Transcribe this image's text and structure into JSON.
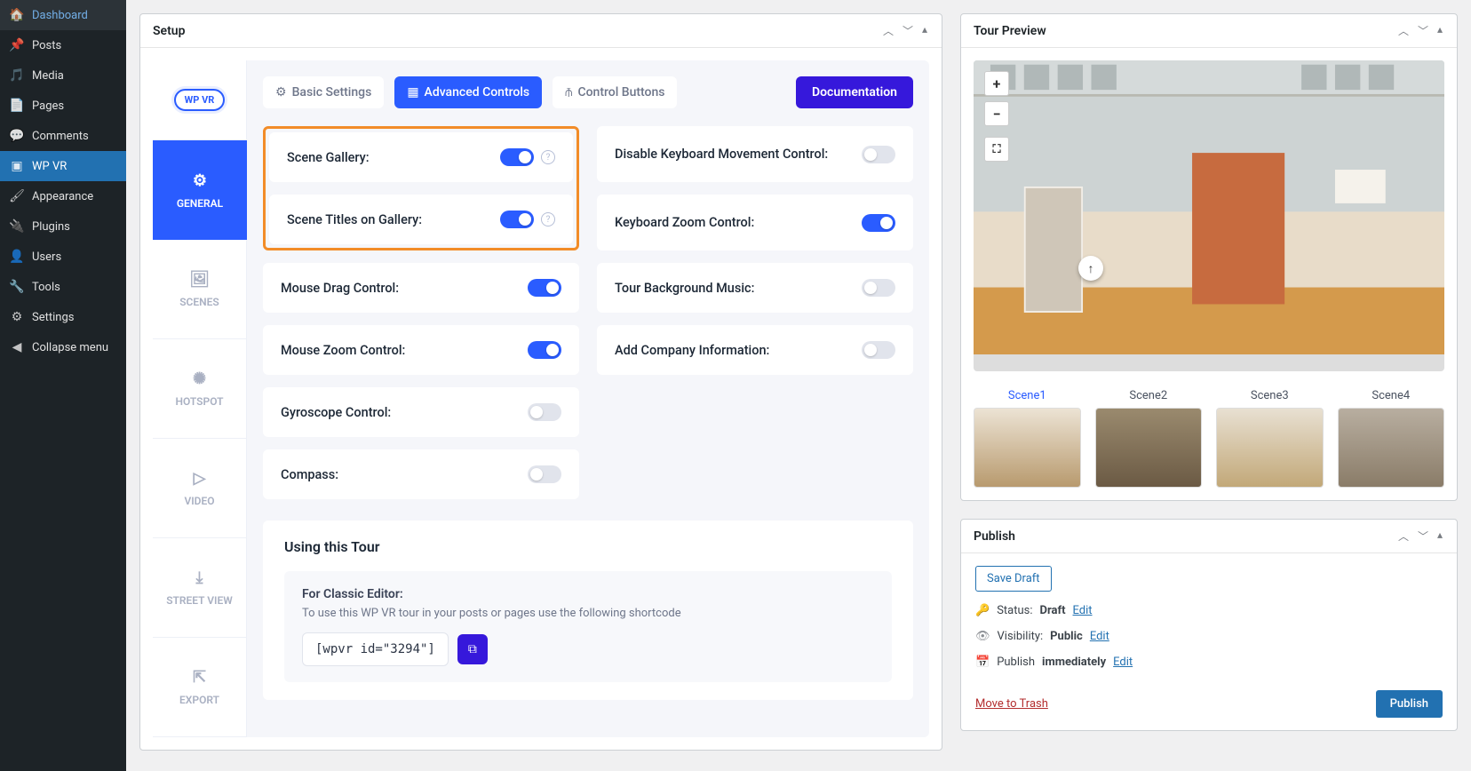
{
  "nav": {
    "items": [
      {
        "label": "Dashboard",
        "icon": "◈"
      },
      {
        "label": "Posts",
        "icon": "✎"
      },
      {
        "label": "Media",
        "icon": "🖾"
      },
      {
        "label": "Pages",
        "icon": "▤"
      },
      {
        "label": "Comments",
        "icon": "✉"
      },
      {
        "label": "WP VR",
        "icon": "▢"
      },
      {
        "label": "Appearance",
        "icon": "✦"
      },
      {
        "label": "Plugins",
        "icon": "⚡"
      },
      {
        "label": "Users",
        "icon": "👤"
      },
      {
        "label": "Tools",
        "icon": "🔧"
      },
      {
        "label": "Settings",
        "icon": "⚙"
      },
      {
        "label": "Collapse menu",
        "icon": "◀"
      }
    ],
    "active_index": 5
  },
  "setup": {
    "title": "Setup",
    "logo": "WP VR",
    "side_tabs": [
      {
        "label": "GENERAL",
        "icon": "⚙"
      },
      {
        "label": "SCENES",
        "icon": "🖼"
      },
      {
        "label": "HOTSPOT",
        "icon": "✺"
      },
      {
        "label": "VIDEO",
        "icon": "▷"
      },
      {
        "label": "STREET VIEW",
        "icon": "⤓"
      },
      {
        "label": "EXPORT",
        "icon": "⇱"
      }
    ],
    "sub_tabs": {
      "basic": "Basic Settings",
      "advanced": "Advanced Controls",
      "buttons": "Control Buttons"
    },
    "doc_btn": "Documentation",
    "controls": {
      "left": [
        {
          "label": "Disable Keyboard Movement Control:",
          "on": false
        },
        {
          "label": "Keyboard Zoom Control:",
          "on": true
        },
        {
          "label": "Mouse Drag Control:",
          "on": true
        },
        {
          "label": "Mouse Zoom Control:",
          "on": true
        },
        {
          "label": "Gyroscope Control:",
          "on": false
        },
        {
          "label": "Compass:",
          "on": false
        }
      ],
      "right_highlight": [
        {
          "label": "Scene Gallery:",
          "on": true,
          "info": true
        },
        {
          "label": "Scene Titles on Gallery:",
          "on": true,
          "info": true
        }
      ],
      "right_rest": [
        {
          "label": "Tour Background Music:",
          "on": false
        },
        {
          "label": "Add Company Information:",
          "on": false
        }
      ]
    },
    "using": {
      "heading": "Using this Tour",
      "hint": "For Classic Editor:",
      "desc": "To use this WP VR tour in your posts or pages use the following shortcode",
      "shortcode": "[wpvr id=\"3294\"]"
    }
  },
  "preview": {
    "title": "Tour Preview",
    "zoom_in": "+",
    "zoom_out": "−",
    "fullscreen": "⛶",
    "scenes": [
      "Scene1",
      "Scene2",
      "Scene3",
      "Scene4"
    ],
    "active_scene": 0
  },
  "publish": {
    "title": "Publish",
    "save_draft": "Save Draft",
    "status_label": "Status:",
    "status_value": "Draft",
    "status_edit": "Edit",
    "visibility_label": "Visibility:",
    "visibility_value": "Public",
    "visibility_edit": "Edit",
    "publish_label": "Publish",
    "publish_value": "immediately",
    "publish_edit": "Edit",
    "trash": "Move to Trash",
    "publish_btn": "Publish"
  }
}
